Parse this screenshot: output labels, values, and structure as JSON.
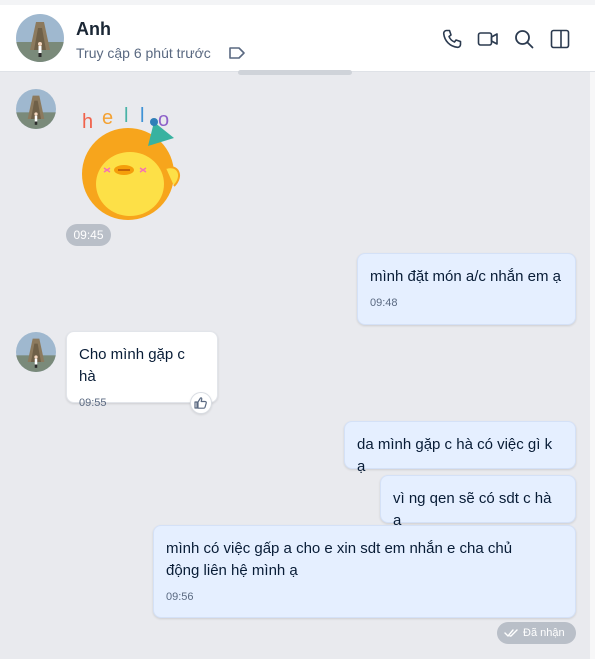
{
  "header": {
    "name": "Anh",
    "status": "Truy cập 6 phút trước",
    "buttons": [
      "phone-icon",
      "video-call-icon",
      "search-icon",
      "sidebar-toggle-icon"
    ]
  },
  "colors": {
    "background": "#e9eaee",
    "sent_bubble": "#e5efff",
    "received_bubble": "#ffffff",
    "time_pill": "#b9bfc8",
    "sticker_yellow": "#fde047",
    "sticker_orange": "#f7a51c"
  },
  "sticker": {
    "text_letters": [
      "h",
      "e",
      "l",
      "l",
      "o"
    ],
    "time": "09:45"
  },
  "messages": [
    {
      "from": "me",
      "text": "mình đặt món a/c nhắn em ạ",
      "time": "09:48"
    },
    {
      "from": "them",
      "text": "Cho mình gặp c hà",
      "time": "09:55"
    },
    {
      "from": "me",
      "text": "da mình gặp c hà có việc gì k ạ",
      "time": ""
    },
    {
      "from": "me",
      "text": "vì ng qen sẽ có sdt c hà ạ",
      "time": ""
    },
    {
      "from": "me",
      "text": "mình có việc gấp a cho e xin sdt em nhắn e cha chủ động liên hệ mình ạ",
      "time": "09:56"
    }
  ],
  "seen_status": "Đã nhận"
}
